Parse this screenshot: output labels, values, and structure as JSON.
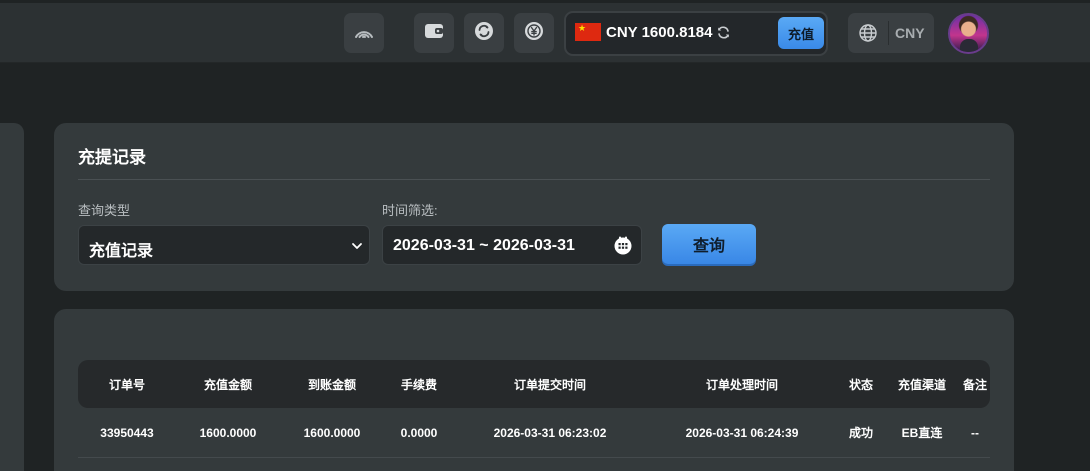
{
  "topbar": {
    "balance": {
      "currency": "CNY",
      "amount": "1600.8184",
      "recharge_label": "充值"
    },
    "language": {
      "currency_label": "CNY"
    }
  },
  "filter_card": {
    "title": "充提记录",
    "query_type_label": "查询类型",
    "query_type_value": "充值记录",
    "time_filter_label": "时间筛选:",
    "date_range": "2026-03-31 ~ 2026-03-31",
    "query_button": "查询"
  },
  "records_table": {
    "headers": [
      "订单号",
      "充值金额",
      "到账金额",
      "手续费",
      "订单提交时间",
      "订单处理时间",
      "状态",
      "充值渠道",
      "备注"
    ],
    "rows": [
      [
        "33950443",
        "1600.0000",
        "1600.0000",
        "0.0000",
        "2026-03-31 06:23:02",
        "2026-03-31 06:24:39",
        "成功",
        "EB直连",
        "--"
      ]
    ]
  },
  "colors": {
    "accent": "#4a9cf0",
    "background": "#1f2324",
    "card": "#343a3c",
    "topbar": "#2c3133"
  }
}
